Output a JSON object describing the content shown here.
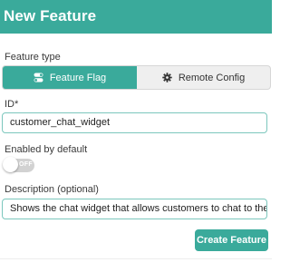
{
  "dialog": {
    "title": "New Feature"
  },
  "feature_type": {
    "label": "Feature type",
    "options": [
      {
        "label": "Feature Flag",
        "icon": "toggle-icon",
        "selected": true
      },
      {
        "label": "Remote Config",
        "icon": "gear-icon",
        "selected": false
      }
    ]
  },
  "id_field": {
    "label": "ID*",
    "value": "customer_chat_widget"
  },
  "enabled": {
    "label": "Enabled by default",
    "state_text": "OFF",
    "value": false
  },
  "description": {
    "label": "Description (optional)",
    "value": "Shows the chat widget that allows customers to chat to the support team"
  },
  "actions": {
    "create_label": "Create Feature"
  },
  "colors": {
    "accent": "#3aaa9b",
    "field_border": "#7cc7bd",
    "toggle_off": "#d2d2d2"
  }
}
